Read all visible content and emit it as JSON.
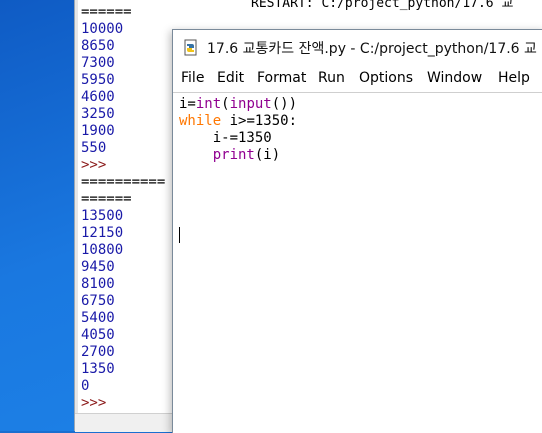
{
  "shell": {
    "top_title": "RESTART: C:/project_python/17.6 교",
    "lines": [
      {
        "text": "======",
        "kind": "sep"
      },
      {
        "text": "10000",
        "kind": "out"
      },
      {
        "text": "8650",
        "kind": "out"
      },
      {
        "text": "7300",
        "kind": "out"
      },
      {
        "text": "5950",
        "kind": "out"
      },
      {
        "text": "4600",
        "kind": "out"
      },
      {
        "text": "3250",
        "kind": "out"
      },
      {
        "text": "1900",
        "kind": "out"
      },
      {
        "text": "550",
        "kind": "out"
      },
      {
        "text": ">>>",
        "kind": "prompt"
      },
      {
        "text": "==========",
        "kind": "sep"
      },
      {
        "text": "======",
        "kind": "sep"
      },
      {
        "text": "13500",
        "kind": "out"
      },
      {
        "text": "12150",
        "kind": "out"
      },
      {
        "text": "10800",
        "kind": "out"
      },
      {
        "text": "9450",
        "kind": "out"
      },
      {
        "text": "8100",
        "kind": "out"
      },
      {
        "text": "6750",
        "kind": "out"
      },
      {
        "text": "5400",
        "kind": "out"
      },
      {
        "text": "4050",
        "kind": "out"
      },
      {
        "text": "2700",
        "kind": "out"
      },
      {
        "text": "1350",
        "kind": "out"
      },
      {
        "text": "0",
        "kind": "out"
      },
      {
        "text": ">>>",
        "kind": "prompt"
      }
    ]
  },
  "editor": {
    "title": "17.6 교통카드 잔액.py - C:/project_python/17.6 교",
    "icon": "python-file-icon",
    "menu": [
      "File",
      "Edit",
      "Format",
      "Run",
      "Options",
      "Window",
      "Help"
    ],
    "code_lines": [
      [
        {
          "t": "i=",
          "c": "plain"
        },
        {
          "t": "int",
          "c": "bi"
        },
        {
          "t": "(",
          "c": "plain"
        },
        {
          "t": "input",
          "c": "bi"
        },
        {
          "t": "())",
          "c": "plain"
        }
      ],
      [
        {
          "t": "while",
          "c": "kw"
        },
        {
          "t": " i>=1350:",
          "c": "plain"
        }
      ],
      [
        {
          "t": "    i-=1350",
          "c": "plain"
        }
      ],
      [
        {
          "t": "    ",
          "c": "plain"
        },
        {
          "t": "print",
          "c": "bi"
        },
        {
          "t": "(i)",
          "c": "plain"
        }
      ]
    ]
  },
  "colors": {
    "keyword": "#ff7700",
    "builtin": "#900090",
    "output": "#1a1aa8",
    "prompt": "#8b1a1a"
  }
}
